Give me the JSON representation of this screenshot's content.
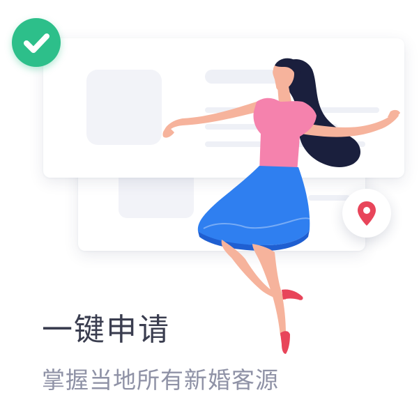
{
  "title": "一键申请",
  "subtitle": "掌握当地所有新婚客源",
  "icons": {
    "check": "checkmark-icon",
    "location": "location-pin-icon"
  },
  "colors": {
    "check_badge": "#2dbf8a",
    "location_pin": "#e8455a",
    "title": "#3a3d4f",
    "subtitle": "#8f92a6",
    "shirt": "#f582ad",
    "skirt": "#2f7ff0",
    "hair": "#1a1f3d"
  }
}
